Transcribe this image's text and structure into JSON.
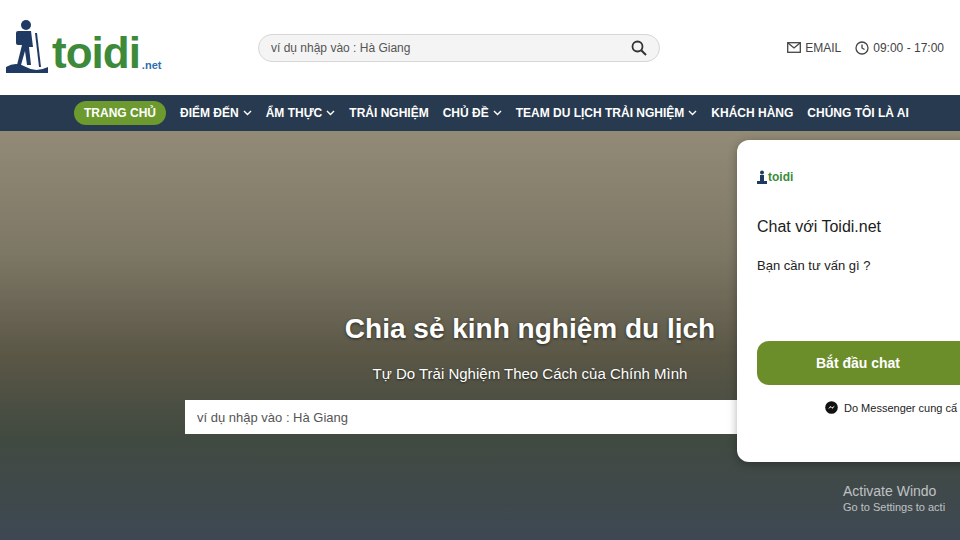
{
  "header": {
    "logo": {
      "name": "toidi",
      "suffix": ".net"
    },
    "search": {
      "placeholder": "ví dụ nhập vào : Hà Giang"
    },
    "email": "EMAIL",
    "hours": "09:00 - 17:00"
  },
  "nav": [
    {
      "label": "TRANG CHỦ",
      "has_dropdown": false,
      "selected": true
    },
    {
      "label": "ĐIỂM ĐẾN",
      "has_dropdown": true,
      "selected": false
    },
    {
      "label": "ẨM THỰC",
      "has_dropdown": true,
      "selected": false
    },
    {
      "label": "TRẢI NGHIỆM",
      "has_dropdown": false,
      "selected": false
    },
    {
      "label": "CHỦ ĐỀ",
      "has_dropdown": true,
      "selected": false
    },
    {
      "label": "TEAM DU LỊCH TRẢI NGHIỆM",
      "has_dropdown": true,
      "selected": false
    },
    {
      "label": "KHÁCH HÀNG",
      "has_dropdown": false,
      "selected": false
    },
    {
      "label": "CHÚNG TÔI LÀ AI",
      "has_dropdown": false,
      "selected": false
    }
  ],
  "hero": {
    "title": "Chia sẻ kinh nghiệm du lịch",
    "subtitle": "Tự Do Trải Nghiệm Theo Cách của Chính Mình",
    "search": {
      "placeholder": "ví dụ nhập vào : Hà Giang"
    }
  },
  "chat": {
    "logo": "toidi",
    "title": "Chat với Toidi.net",
    "prompt": "Bạn cần tư vấn gì ?",
    "button": "Bắt đầu chat",
    "footer": "Do Messenger cung cấ"
  },
  "watermark": [
    "Activate Windo",
    "Go to Settings to acti"
  ]
}
